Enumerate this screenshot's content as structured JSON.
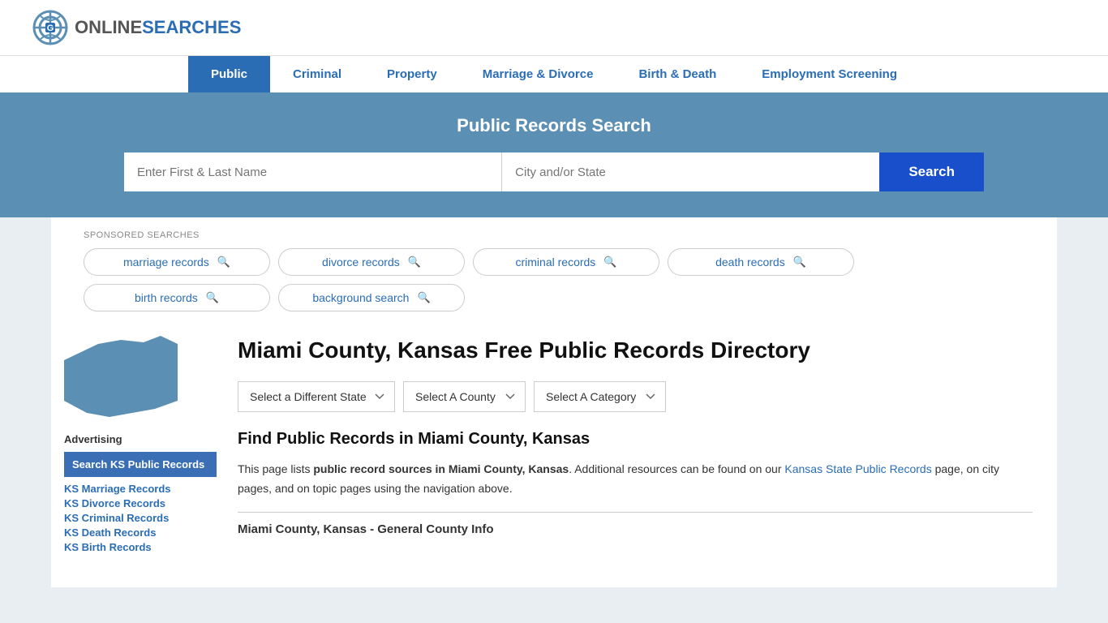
{
  "header": {
    "logo_text_online": "ONLINE",
    "logo_text_searches": "SEARCHES"
  },
  "nav": {
    "items": [
      {
        "label": "Public",
        "active": true
      },
      {
        "label": "Criminal",
        "active": false
      },
      {
        "label": "Property",
        "active": false
      },
      {
        "label": "Marriage & Divorce",
        "active": false
      },
      {
        "label": "Birth & Death",
        "active": false
      },
      {
        "label": "Employment Screening",
        "active": false
      }
    ]
  },
  "hero": {
    "title": "Public Records Search",
    "name_placeholder": "Enter First & Last Name",
    "location_placeholder": "City and/or State",
    "search_button": "Search"
  },
  "sponsored": {
    "label": "SPONSORED SEARCHES",
    "pills": [
      {
        "label": "marriage records"
      },
      {
        "label": "divorce records"
      },
      {
        "label": "criminal records"
      },
      {
        "label": "death records"
      },
      {
        "label": "birth records"
      },
      {
        "label": "background search"
      }
    ]
  },
  "sidebar": {
    "advertising_label": "Advertising",
    "ad_box_label": "Search KS Public Records",
    "links": [
      {
        "label": "KS Marriage Records"
      },
      {
        "label": "KS Divorce Records"
      },
      {
        "label": "KS Criminal Records"
      },
      {
        "label": "KS Death Records"
      },
      {
        "label": "KS Birth Records"
      }
    ]
  },
  "main": {
    "page_title": "Miami County, Kansas Free Public Records Directory",
    "dropdowns": {
      "state_label": "Select a Different State",
      "county_label": "Select A County",
      "category_label": "Select A Category"
    },
    "find_title": "Find Public Records in Miami County, Kansas",
    "description_1": "This page lists ",
    "description_bold": "public record sources in Miami County, Kansas",
    "description_2": ". Additional resources can be found on our ",
    "description_link": "Kansas State Public Records",
    "description_3": " page, on city pages, and on topic pages using the navigation above.",
    "section_title": "Miami County, Kansas - General County Info"
  }
}
